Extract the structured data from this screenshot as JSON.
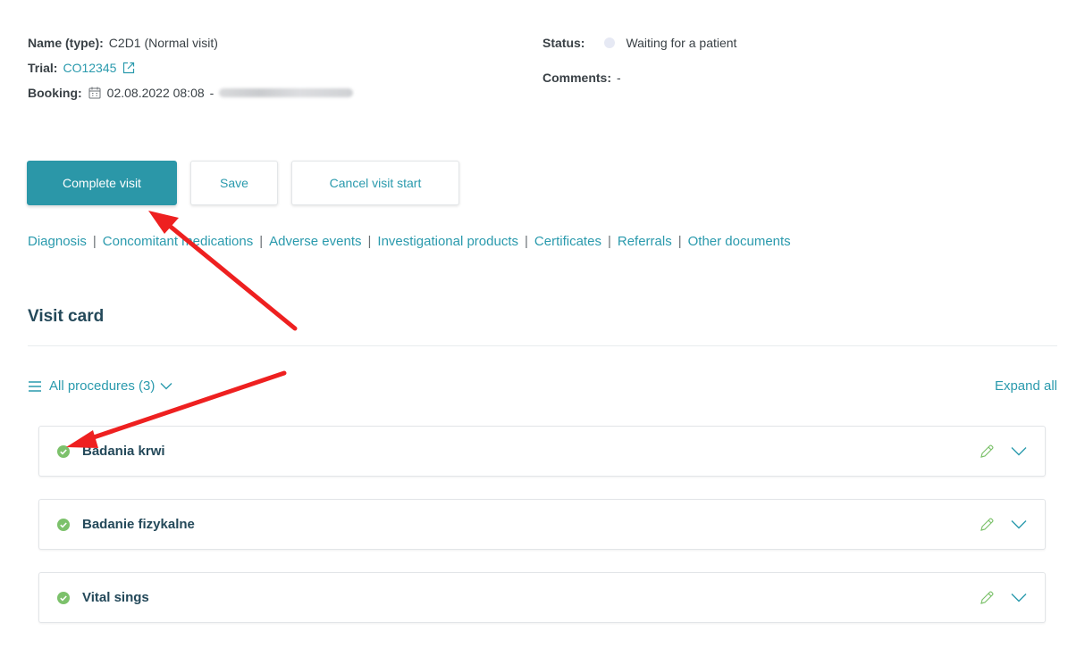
{
  "visit": {
    "name_label": "Name (type):",
    "name_value": "C2D1 (Normal visit)",
    "trial_label": "Trial:",
    "trial_value": "CO12345",
    "booking_label": "Booking:",
    "booking_value": "02.08.2022 08:08",
    "booking_sep": "-",
    "status_label": "Status:",
    "status_value": "Waiting for a patient",
    "comments_label": "Comments:",
    "comments_value": "-"
  },
  "actions": {
    "complete_label": "Complete visit",
    "save_label": "Save",
    "cancel_label": "Cancel visit start"
  },
  "doc_links": [
    "Diagnosis",
    "Concomitant medications",
    "Adverse events",
    "Investigational products",
    "Certificates",
    "Referrals",
    "Other documents"
  ],
  "doc_separator": "|",
  "visit_card": {
    "title": "Visit card",
    "filter_label": "All procedures (3)",
    "expand_all_label": "Expand all"
  },
  "procedures": [
    {
      "name": "Badania krwi",
      "status": "completed"
    },
    {
      "name": "Badanie fizykalne",
      "status": "completed"
    },
    {
      "name": "Vital sings",
      "status": "completed"
    }
  ],
  "colors": {
    "accent": "#2b97a8",
    "link": "#2a9aad",
    "title": "#24495a",
    "check": "#7cc16b",
    "annotation_arrow": "#ee2020",
    "status_dot": "#e6e9f4"
  },
  "icons": {
    "external": "external-link-icon",
    "calendar": "building-calendar-icon",
    "status": "status-dot-icon",
    "menu": "menu-lines-icon",
    "chevron": "chevron-down-icon",
    "check": "check-circle-icon",
    "edit": "pencil-icon"
  }
}
